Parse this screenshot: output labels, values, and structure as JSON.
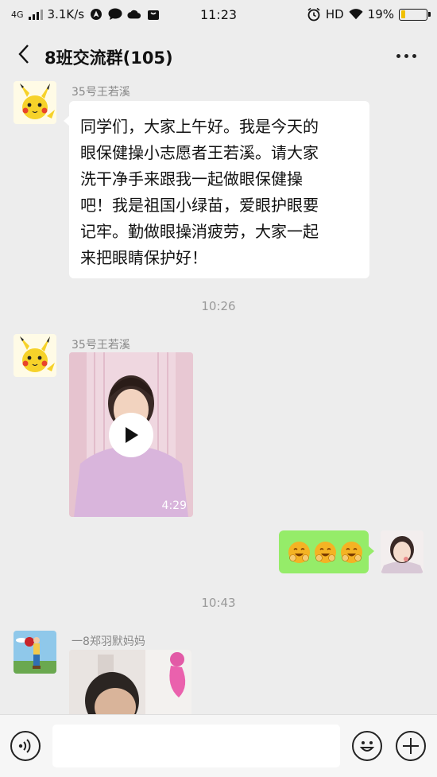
{
  "status_bar": {
    "network": "4G",
    "speed": "3.1K/s",
    "time": "11:23",
    "hd": "HD",
    "battery": "19%",
    "battery_level": 0.19
  },
  "title_bar": {
    "title": "8班交流群(105)"
  },
  "messages": {
    "msg1": {
      "sender": "35号王若溪",
      "lines": [
        "同学们，大家上午好。我是今天的",
        "眼保健操小志愿者王若溪。请大家",
        "洗干净手来跟我一起做眼保健操",
        "吧！我是祖国小绿苗，爱眼护眼要",
        "记牢。勤做眼操消疲劳，大家一起",
        "来把眼睛保护好！"
      ]
    },
    "time1": "10:26",
    "msg2": {
      "sender": "35号王若溪",
      "duration": "4:29"
    },
    "time2": "10:43",
    "msg4": {
      "sender": "一8郑羽默妈妈"
    }
  },
  "colors": {
    "background": "#ededed",
    "bubble_self": "#95ec69",
    "bubble_other": "#ffffff",
    "emoji": "#f4b324"
  },
  "icons": {
    "back": "chevron-left-icon",
    "more": "ellipsis-icon",
    "voice": "voice-icon",
    "emoji": "smiley-icon",
    "plus": "plus-icon",
    "play": "play-icon"
  }
}
